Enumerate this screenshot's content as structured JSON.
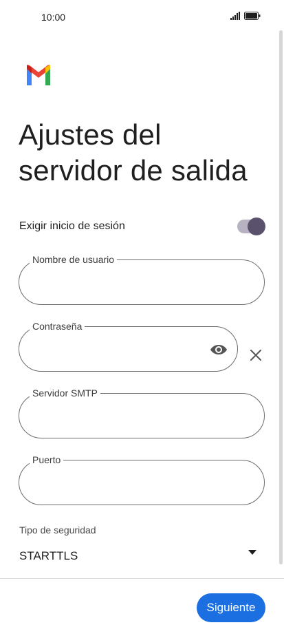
{
  "status_bar": {
    "time": "10:00"
  },
  "app": {
    "logo": "gmail-logo"
  },
  "page": {
    "title": "Ajustes del servidor de salida"
  },
  "login_required": {
    "label": "Exigir inicio de sesión",
    "enabled": true
  },
  "fields": {
    "username": {
      "label": "Nombre de usuario",
      "value": ""
    },
    "password": {
      "label": "Contraseña",
      "value": ""
    },
    "smtp_server": {
      "label": "Servidor SMTP",
      "value": ""
    },
    "port": {
      "label": "Puerto",
      "value": ""
    }
  },
  "security": {
    "label": "Tipo de seguridad",
    "value": "STARTTLS"
  },
  "footer": {
    "next_label": "Siguiente"
  },
  "colors": {
    "accent": "#1b6fe0",
    "toggle_knob": "#5a526d",
    "toggle_track": "#b7b2c2"
  }
}
